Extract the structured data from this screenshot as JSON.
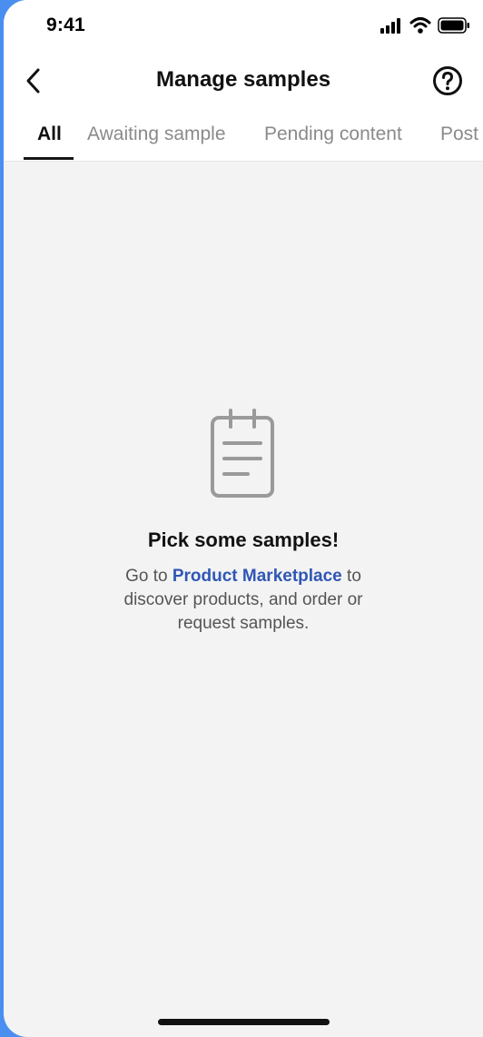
{
  "status_bar": {
    "time": "9:41",
    "icons": [
      "signal-icon",
      "wifi-icon",
      "battery-icon"
    ]
  },
  "header": {
    "title": "Manage samples",
    "back_icon": "chevron-left-icon",
    "help_icon": "question-circle-icon"
  },
  "tabs": [
    {
      "label": "All",
      "active": true
    },
    {
      "label": "Awaiting sample",
      "active": false
    },
    {
      "label": "Pending content",
      "active": false
    },
    {
      "label": "Post",
      "active": false
    }
  ],
  "empty_state": {
    "icon": "notepad-icon",
    "title": "Pick some samples!",
    "desc_prefix": "Go to ",
    "link_text": "Product Marketplace",
    "desc_suffix": " to discover products, and order or request samples."
  },
  "colors": {
    "accent": "#2f57b5",
    "background": "#f3f3f3",
    "frame": "#4a8ff0"
  }
}
